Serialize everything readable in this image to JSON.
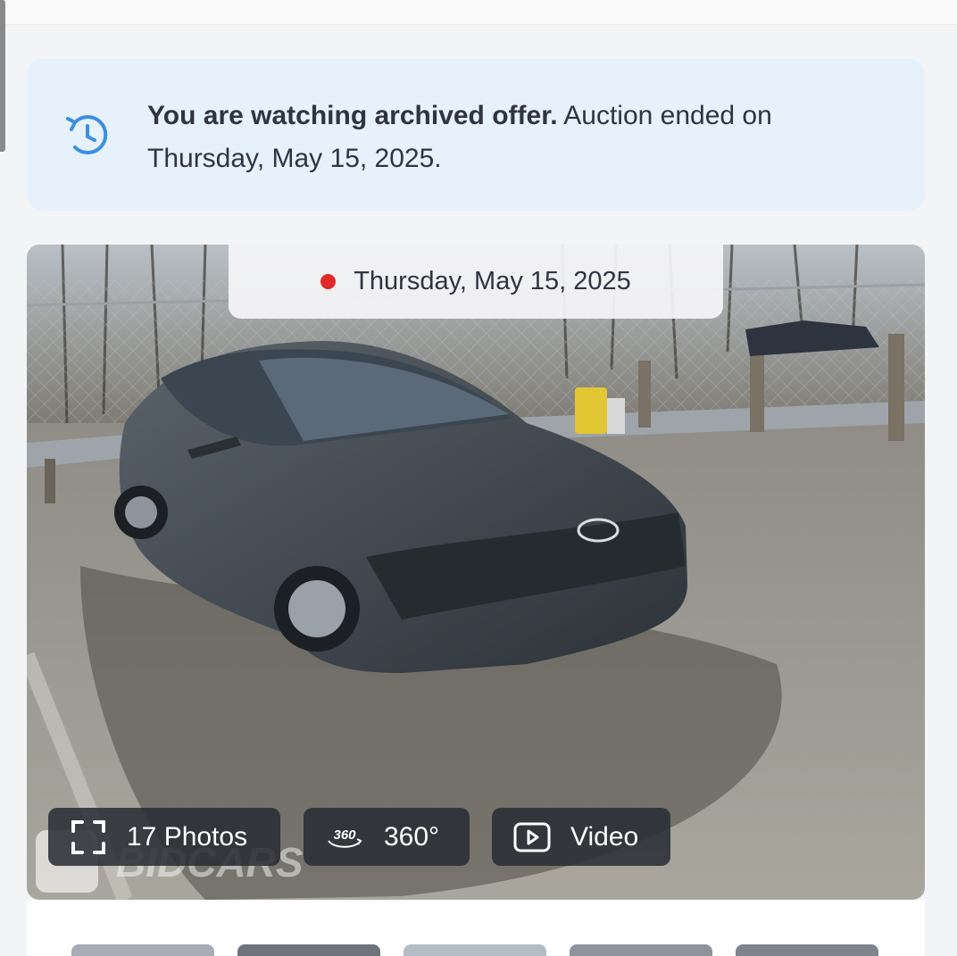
{
  "notice": {
    "bold": "You are watching archived offer.",
    "rest": " Auction ended on Thursday, May 15, 2025.",
    "icon": "history-icon",
    "accent": "#3b8fe0"
  },
  "gallery": {
    "date_label": "Thursday, May 15, 2025",
    "status_dot_color": "#e02a2a",
    "photos_label": "17 Photos",
    "view360_badge": "360",
    "view360_label": "360°",
    "video_label": "Video",
    "watermark": "BIDCARS"
  },
  "thumbnails": [
    "thumb-1",
    "thumb-2",
    "thumb-3",
    "thumb-4",
    "thumb-5"
  ]
}
